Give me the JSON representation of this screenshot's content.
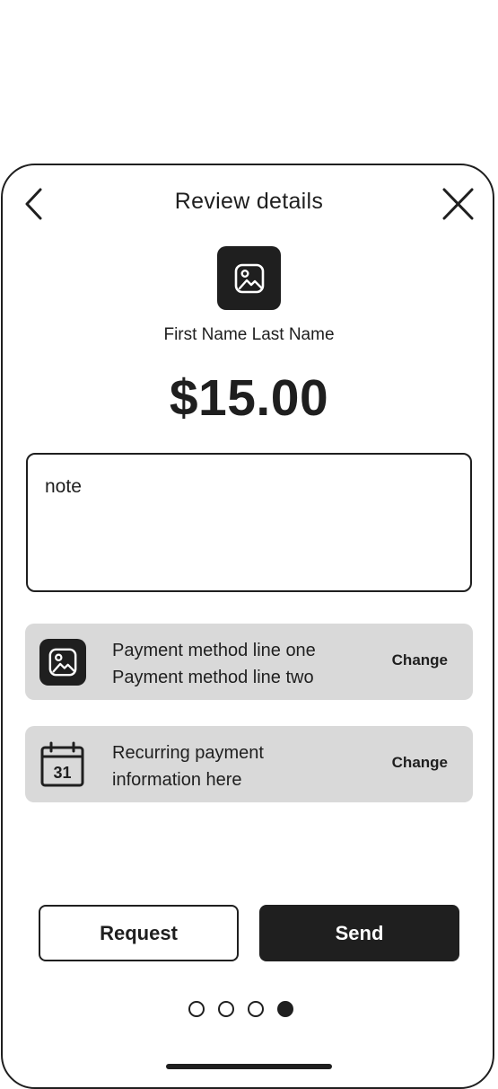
{
  "header": {
    "title": "Review details",
    "back_icon": "chevron-left-icon",
    "close_icon": "close-icon"
  },
  "recipient": {
    "name": "First Name Last Name",
    "avatar_icon": "image-icon"
  },
  "amount": "$15.00",
  "note": {
    "placeholder": "note"
  },
  "payment_method": {
    "icon": "image-icon",
    "line_one": "Payment method line one",
    "line_two": "Payment method line two",
    "change_label": "Change"
  },
  "recurring": {
    "icon": "calendar-icon",
    "calendar_day": "31",
    "line_one": "Recurring payment",
    "line_two": "information here",
    "change_label": "Change"
  },
  "actions": {
    "request_label": "Request",
    "send_label": "Send"
  },
  "pagination": {
    "total": 4,
    "active_index": 3
  },
  "colors": {
    "primary": "#1f1f1f",
    "card_bg": "#d9d9d9",
    "background": "#ffffff"
  }
}
